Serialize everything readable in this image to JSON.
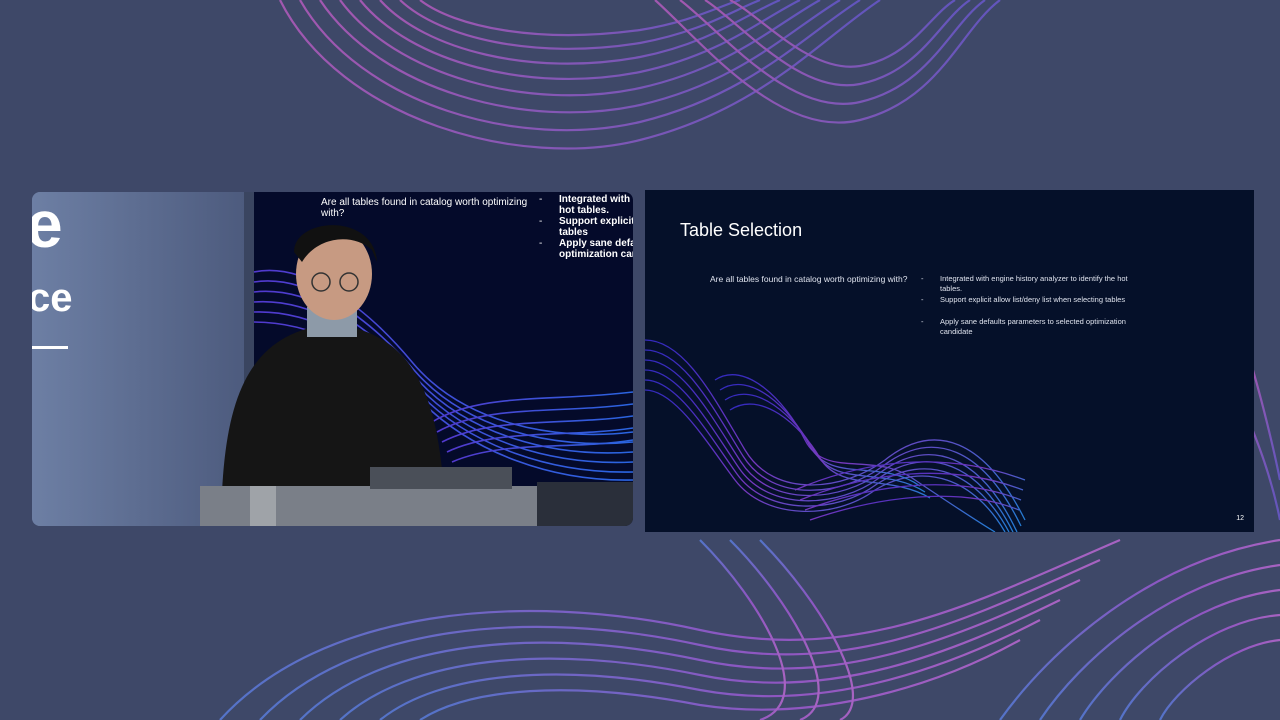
{
  "logo": {
    "top_fragment": "e",
    "middle_fragment": "ce"
  },
  "projection": {
    "question_text": "Are all tables found in catalog worth optimizing with?",
    "bullets": [
      {
        "dash": "-",
        "text": "Integrated with engi"
      },
      {
        "dash": "",
        "text": "hot tables."
      },
      {
        "dash": "-",
        "text": "Support explicit allo"
      },
      {
        "dash": "",
        "text": "tables"
      },
      {
        "dash": "-",
        "text": "Apply sane defaults"
      },
      {
        "dash": "",
        "text": "optimization candid"
      }
    ]
  },
  "slide": {
    "title": "Table Selection",
    "question": "Are all tables found in catalog worth optimizing with?",
    "bullets": [
      {
        "dash": "-",
        "text": "Integrated with engine history analyzer to identify the hot tables."
      },
      {
        "dash": "-",
        "text": "Support explicit allow list/deny list when selecting tables"
      },
      {
        "dash": "-",
        "text": "Apply sane defaults parameters to selected optimization candidate"
      }
    ],
    "page_number": "12"
  },
  "colors": {
    "page_background": "#3e4868",
    "slide_background": "#051029",
    "wave_purple": "#9b4fd6",
    "wave_blue": "#3c58e6"
  }
}
